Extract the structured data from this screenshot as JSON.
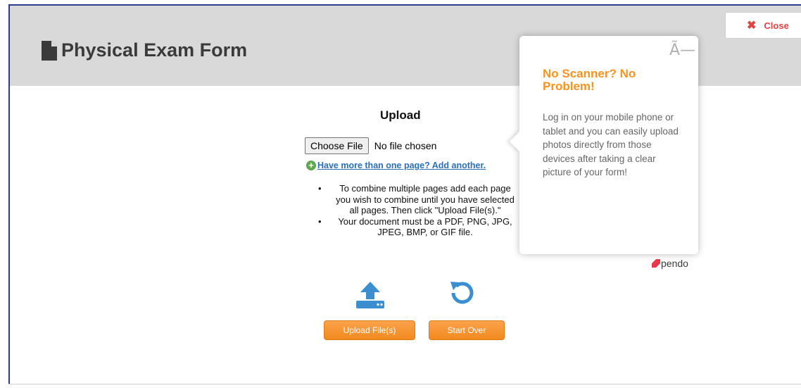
{
  "header": {
    "title": "Physical Exam Form"
  },
  "close_button": {
    "label": "Close"
  },
  "upload": {
    "heading": "Upload",
    "choose_file_label": "Choose File",
    "file_status": "No file chosen",
    "add_another_link": "Have more than one page? Add another.",
    "instructions": [
      "To combine multiple pages add each page you wish to combine until you have selected all pages. Then click \"Upload File(s).\"",
      "Your document must be a PDF, PNG, JPG, JPEG, BMP, or GIF file."
    ],
    "upload_button": "Upload File(s)",
    "start_over_button": "Start Over"
  },
  "popup": {
    "close_glyph": "Ã—",
    "title": "No Scanner? No Problem!",
    "body": "Log in on your mobile phone or tablet and you can easily upload photos directly from those devices after taking a clear picture of your form!",
    "brand": "pendo"
  },
  "icons": {
    "document": "document-icon",
    "close": "close-x-icon",
    "add": "add-circle-icon",
    "upload": "upload-icon",
    "restart": "restart-icon",
    "pendo": "pendo-logo-icon"
  },
  "colors": {
    "accent_orange": "#f7931e",
    "close_red": "#e04343",
    "icon_blue": "#3b8fd1",
    "link_blue": "#2b6fb6",
    "header_gray": "#d9d9d9"
  }
}
